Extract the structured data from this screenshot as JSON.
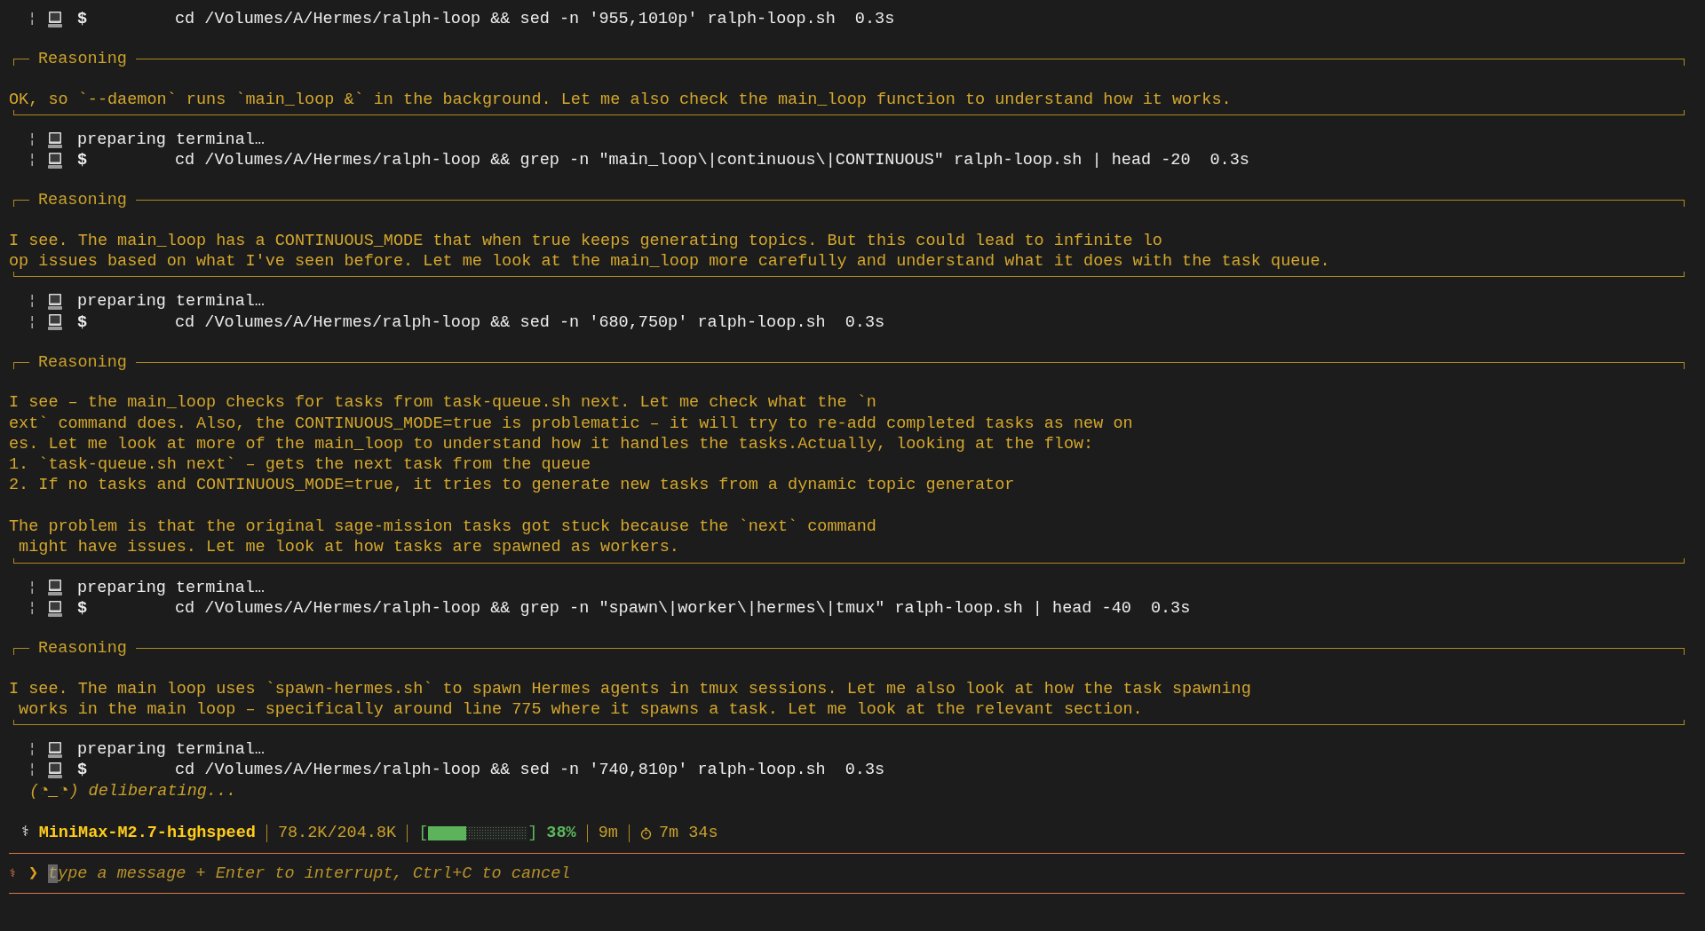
{
  "transcript": [
    {
      "kind": "tool",
      "lines": [
        {
          "kind": "command",
          "marker": "¦",
          "prompt": "$",
          "command": "cd /Volumes/A/Hermes/ralph-loop && sed -n '955,1010p' ralph-loop.sh",
          "duration": "0.3s"
        }
      ]
    },
    {
      "kind": "reasoning",
      "title": "Reasoning",
      "paragraphs": [
        [
          "OK, so `--daemon` runs `main_loop &` in the background. Let me also check the main_loop function to understand how it works."
        ]
      ]
    },
    {
      "kind": "tool",
      "lines": [
        {
          "kind": "preparing",
          "marker": "¦",
          "text": "preparing terminal…"
        },
        {
          "kind": "command",
          "marker": "¦",
          "prompt": "$",
          "command": "cd /Volumes/A/Hermes/ralph-loop && grep -n \"main_loop\\|continuous\\|CONTINUOUS\" ralph-loop.sh | head -20",
          "duration": "0.3s"
        }
      ]
    },
    {
      "kind": "reasoning",
      "title": "Reasoning",
      "paragraphs": [
        [
          "I see. The main_loop has a CONTINUOUS_MODE that when true keeps generating topics. But this could lead to infinite lo",
          "op issues based on what I've seen before. Let me look at the main_loop more carefully and understand what it does with the task queue."
        ]
      ]
    },
    {
      "kind": "tool",
      "lines": [
        {
          "kind": "preparing",
          "marker": "¦",
          "text": "preparing terminal…"
        },
        {
          "kind": "command",
          "marker": "¦",
          "prompt": "$",
          "command": "cd /Volumes/A/Hermes/ralph-loop && sed -n '680,750p' ralph-loop.sh",
          "duration": "0.3s"
        }
      ]
    },
    {
      "kind": "reasoning",
      "title": "Reasoning",
      "paragraphs": [
        [
          "I see – the main_loop checks for tasks from task-queue.sh next. Let me check what the `n",
          "ext` command does. Also, the CONTINUOUS_MODE=true is problematic – it will try to re-add completed tasks as new on",
          "es. Let me look at more of the main_loop to understand how it handles the tasks.Actually, looking at the flow:",
          "1. `task-queue.sh next` – gets the next task from the queue",
          "2. If no tasks and CONTINUOUS_MODE=true, it tries to generate new tasks from a dynamic topic generator"
        ],
        [
          "The problem is that the original sage-mission tasks got stuck because the `next` command",
          " might have issues. Let me look at how tasks are spawned as workers."
        ]
      ]
    },
    {
      "kind": "tool",
      "lines": [
        {
          "kind": "preparing",
          "marker": "¦",
          "text": "preparing terminal…"
        },
        {
          "kind": "command",
          "marker": "¦",
          "prompt": "$",
          "command": "cd /Volumes/A/Hermes/ralph-loop && grep -n \"spawn\\|worker\\|hermes\\|tmux\" ralph-loop.sh | head -40",
          "duration": "0.3s"
        }
      ]
    },
    {
      "kind": "reasoning",
      "title": "Reasoning",
      "paragraphs": [
        [
          "I see. The main loop uses `spawn-hermes.sh` to spawn Hermes agents in tmux sessions. Let me also look at how the task spawning",
          " works in the main loop – specifically around line 775 where it spawns a task. Let me look at the relevant section."
        ]
      ]
    },
    {
      "kind": "tool",
      "lines": [
        {
          "kind": "preparing",
          "marker": "¦",
          "text": "preparing terminal…"
        },
        {
          "kind": "command",
          "marker": "¦",
          "prompt": "$",
          "command": "cd /Volumes/A/Hermes/ralph-loop && sed -n '740,810p' ralph-loop.sh",
          "duration": "0.3s"
        }
      ]
    }
  ],
  "activity": "(◔_◔) deliberating...",
  "status_bar": {
    "icon": "⚕",
    "model": "MiniMax-M2.7-highspeed",
    "tokens": "78.2K/204.8K",
    "bracket_open": "[",
    "bracket_close": "]",
    "context": {
      "level": 0.38
    },
    "percent": "38%",
    "session": "9m",
    "timer": "7m 34s"
  },
  "input": {
    "icon": "⚕",
    "prompt": "❯",
    "placeholder": "type a message + Enter to interrupt, Ctrl+C to cancel"
  }
}
